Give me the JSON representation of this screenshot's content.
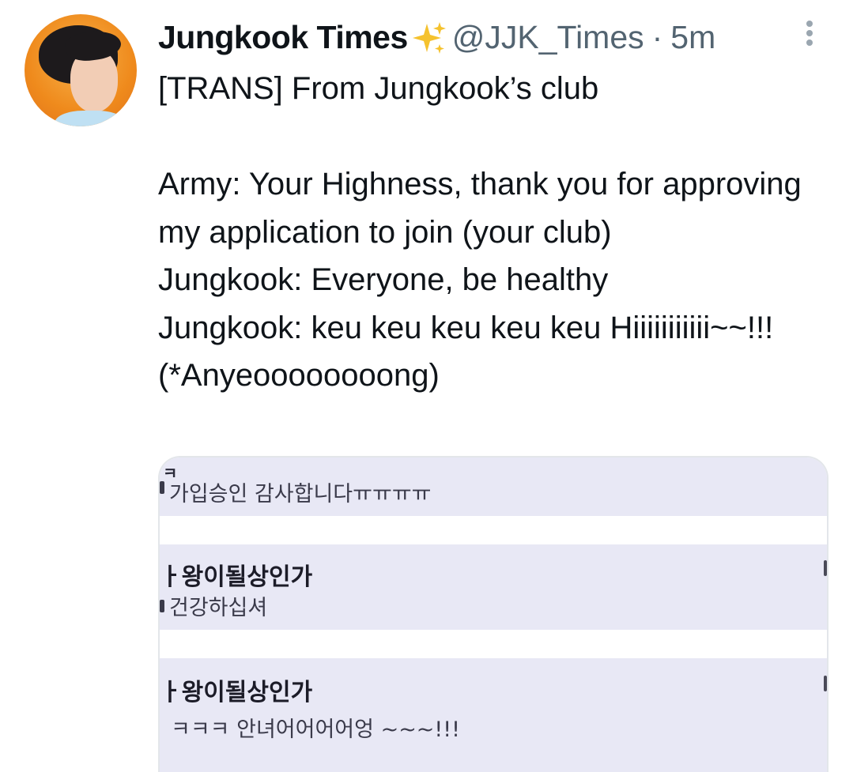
{
  "tweet": {
    "display_name": "Jungkook Times",
    "handle": "@JJK_Times",
    "separator": "·",
    "time": "5m",
    "icons": {
      "sparkle": "sparkles-emoji-icon",
      "more": "more-options-icon"
    },
    "text": "[TRANS] From Jungkook’s club\n\nArmy: Your Highness, thank you for approving my application to join (your club)\nJungkook: Everyone, be healthy\nJungkook: keu keu keu keu keu Hiiiiiiiiiii~~!!! (*Anyeoooooooong)"
  },
  "media": {
    "top_glyph": "ㅋ",
    "line1": "가입승인 감사합니다ㅠㅠㅠㅠ",
    "entry2": {
      "name": "ㅏ왕이될상인가",
      "message": "건강하십셔"
    },
    "entry3": {
      "name": "ㅏ왕이될상인가",
      "message": "ㅋㅋㅋ 안녀어어어어엉 ~~~!!!"
    }
  },
  "colors": {
    "text": "#0f1419",
    "secondary": "#536471",
    "chat_band": "#e8e8f5",
    "avatar_bg": "#ef8a1c",
    "sparkle": "#f5c22e"
  }
}
